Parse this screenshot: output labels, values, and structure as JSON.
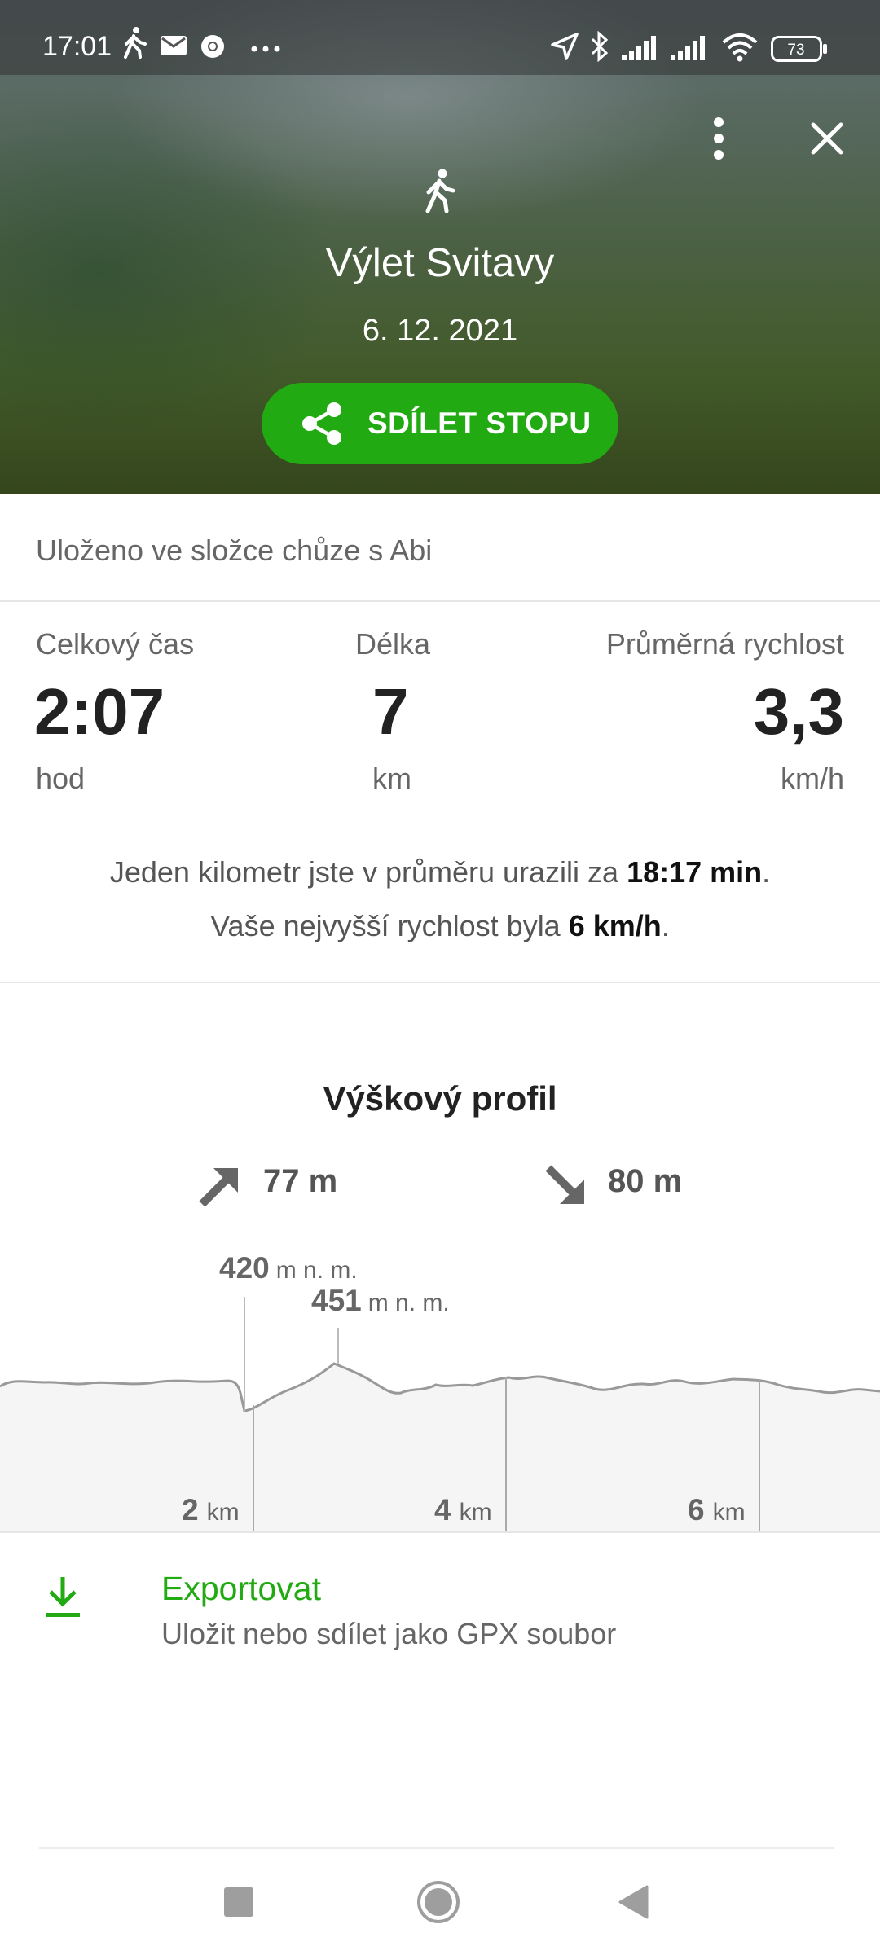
{
  "status_bar": {
    "time": "17:01",
    "battery": "73",
    "icons": [
      "walking-icon",
      "mail-icon",
      "chrome-icon",
      "more-dots-icon",
      "location-arrow-icon",
      "bluetooth-icon",
      "signal-icon",
      "signal-icon",
      "wifi-icon",
      "battery-icon"
    ]
  },
  "header": {
    "activity_icon": "walking-icon",
    "title": "Výlet Svitavy",
    "date": "6. 12. 2021",
    "share_label": "SDÍLET STOPU",
    "accent": "#21aa12"
  },
  "folder": {
    "text": "Uloženo ve složce chůze s Abi"
  },
  "stats": {
    "time": {
      "label": "Celkový čas",
      "value": "2:07",
      "unit": "hod"
    },
    "length": {
      "label": "Délka",
      "value": "7",
      "unit": "km"
    },
    "speed": {
      "label": "Průměrná rychlost",
      "value": "3,3",
      "unit": "km/h"
    }
  },
  "summary": {
    "pace_prefix": "Jeden kilometr jste v průměru urazili za ",
    "pace_value": "18:17 min",
    "pace_suffix": ".",
    "max_prefix": "Vaše nejvyšší rychlost byla ",
    "max_value": "6 km/h",
    "max_suffix": "."
  },
  "elevation": {
    "title": "Výškový profil",
    "ascent": "77 m",
    "descent": "80 m",
    "min_value": "420",
    "max_value": "451",
    "alt_unit": "m n. m.",
    "km_unit": "km",
    "ticks": [
      "2",
      "4",
      "6"
    ]
  },
  "export": {
    "title": "Exportovat",
    "subtitle": "Uložit nebo sdílet jako GPX soubor"
  }
}
